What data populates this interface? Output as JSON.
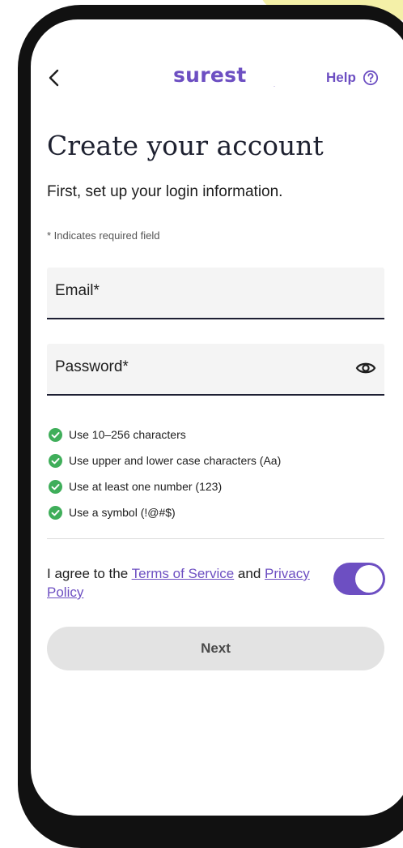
{
  "header": {
    "back_icon": "chevron-left-icon",
    "logo_text": "surest",
    "help_label": "Help",
    "help_icon": "question-circle-icon"
  },
  "page": {
    "title": "Create your account",
    "subtitle": "First, set up your login information.",
    "required_note": "* Indicates required field"
  },
  "form": {
    "email_label": "Email*",
    "email_value": "",
    "password_label": "Password*",
    "password_value": "",
    "password_toggle_icon": "eye-icon"
  },
  "password_rules": [
    {
      "text": "Use 10–256 characters",
      "met": true
    },
    {
      "text": "Use upper and lower case characters (Aa)",
      "met": true
    },
    {
      "text": "Use at least one number (123)",
      "met": true
    },
    {
      "text": "Use a symbol (!@#$)",
      "met": true
    }
  ],
  "agreement": {
    "prefix": "I agree to the ",
    "terms_link": "Terms of Service",
    "middle": " and ",
    "privacy_link": "Privacy Policy",
    "toggle_on": true
  },
  "actions": {
    "next_label": "Next"
  },
  "colors": {
    "brand": "#6d4fc2",
    "check": "#3fae5a",
    "field_underline": "#1d1f33",
    "button_disabled_bg": "#e3e3e3"
  }
}
